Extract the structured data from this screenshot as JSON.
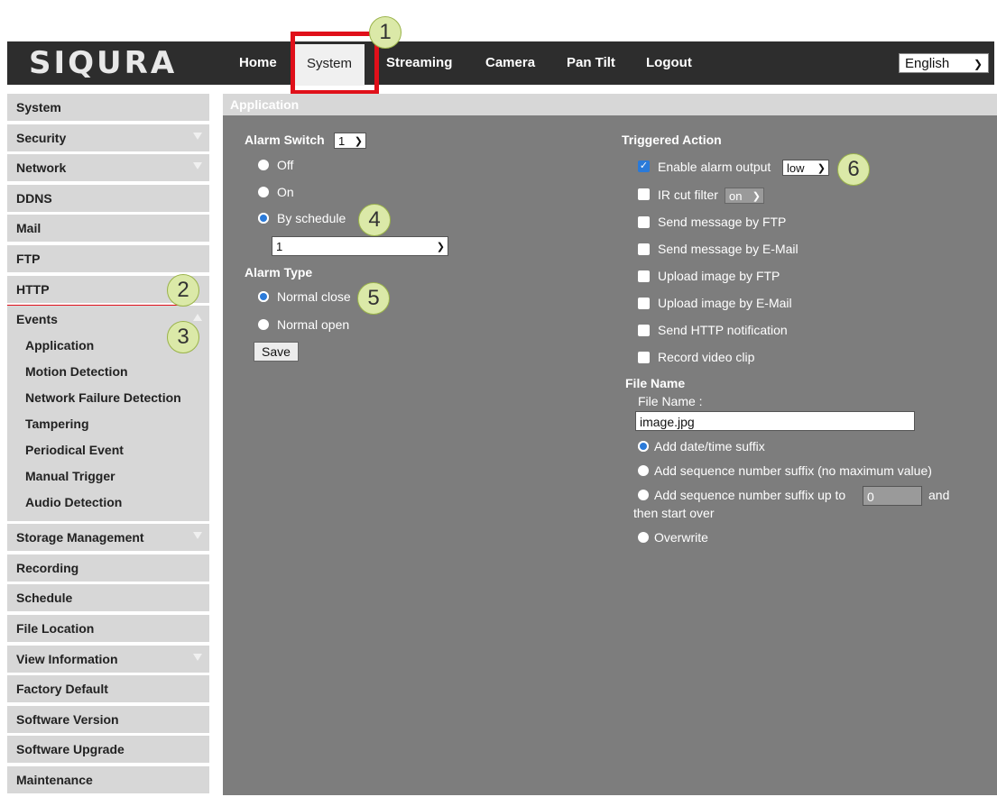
{
  "header": {
    "logo": "SIQURA",
    "nav": [
      "Home",
      "System",
      "Streaming",
      "Camera",
      "Pan Tilt",
      "Logout"
    ],
    "active_nav": "System",
    "language": "English"
  },
  "badges": [
    "1",
    "2",
    "3",
    "4",
    "5",
    "6"
  ],
  "sidebar": {
    "items_top": [
      "System",
      "Security",
      "Network",
      "DDNS",
      "Mail",
      "FTP",
      "HTTP"
    ],
    "events_label": "Events",
    "events_sub": [
      "Application",
      "Motion Detection",
      "Network Failure Detection",
      "Tampering",
      "Periodical Event",
      "Manual Trigger",
      "Audio Detection"
    ],
    "items_bottom": [
      "Storage Management",
      "Recording",
      "Schedule",
      "File Location",
      "View Information",
      "Factory Default",
      "Software Version",
      "Software Upgrade",
      "Maintenance"
    ]
  },
  "main": {
    "header": "Application",
    "alarm_switch_label": "Alarm Switch",
    "alarm_switch_value": "1",
    "switch_options": [
      "Off",
      "On",
      "By schedule"
    ],
    "schedule_value": "1",
    "alarm_type_label": "Alarm Type",
    "alarm_type_options": [
      "Normal close",
      "Normal open"
    ],
    "save": "Save",
    "triggered_action_label": "Triggered Action",
    "enable_alarm_output": "Enable alarm output",
    "alarm_output_value": "low",
    "ir_cut_filter": "IR cut filter",
    "ir_cut_value": "on",
    "actions": [
      "Send message by FTP",
      "Send message by E-Mail",
      "Upload image by FTP",
      "Upload image by E-Mail",
      "Send HTTP notification",
      "Record video clip"
    ],
    "file_name_section": "File Name",
    "file_name_label": "File Name :",
    "file_name_value": "image.jpg",
    "suffix_datetime": "Add date/time suffix",
    "suffix_seq_nomax": "Add sequence number suffix (no maximum value)",
    "suffix_seq_upto": "Add sequence number suffix up to",
    "suffix_seq_value": "0",
    "suffix_and": "and",
    "suffix_then": "then start over",
    "overwrite": "Overwrite"
  }
}
